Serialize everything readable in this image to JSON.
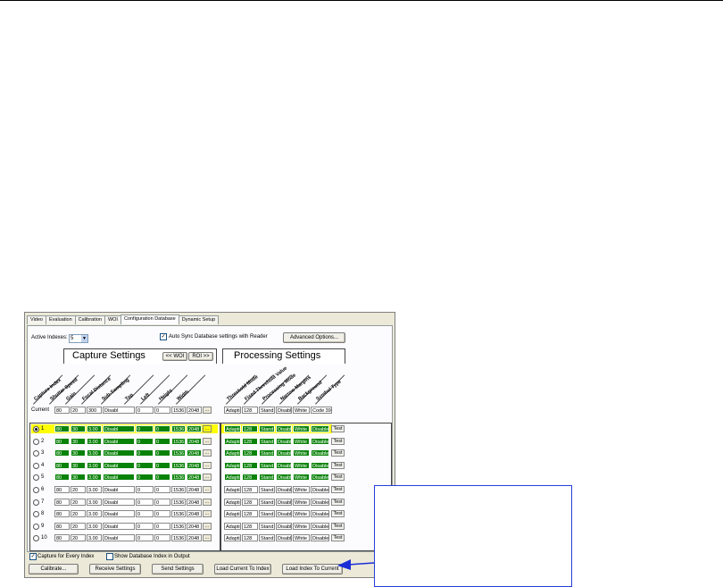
{
  "tabs": [
    {
      "label": "Video"
    },
    {
      "label": "Evaluation"
    },
    {
      "label": "Calibration"
    },
    {
      "label": "WOI"
    },
    {
      "label": "Configuration Database",
      "active": true
    },
    {
      "label": "Dynamic Setup"
    }
  ],
  "active_indexes": {
    "label": "Active Indexes:",
    "value": "5"
  },
  "auto_sync": {
    "label": "Auto Sync Database settings with Reader",
    "checked": true
  },
  "advanced_button": "Advanced Options...",
  "capture_title": "Capture Settings",
  "processing_title": "Processing Settings",
  "woi_button": "<< WOI",
  "roi_button": "ROI >>",
  "capture_columns": [
    "Capture Index",
    "Shutter Speed",
    "Gain",
    "Focal Distance",
    "Sub-Sampling",
    "Top",
    "Left",
    "Height",
    "Width"
  ],
  "processing_columns": [
    "Threshold Mode",
    "Fixed Threshold Value",
    "Processing Mode",
    "Narrow Margins",
    "Background",
    "Symbol Type"
  ],
  "current": {
    "label": "Current",
    "capture": [
      "80",
      "20",
      "300",
      "Disabl",
      "0",
      "0",
      "1536",
      "2048"
    ],
    "ellipsis": "...",
    "processing": [
      "Adapti",
      "128",
      "Stand",
      "Disabl",
      "White",
      "Code 39"
    ]
  },
  "rows": [
    {
      "index": "1",
      "selected": true,
      "active": true,
      "capture": [
        "80",
        "30",
        "3.00",
        "Disabl",
        "0",
        "0",
        "1536",
        "2048"
      ],
      "processing": [
        "Adapti",
        "128",
        "Stand",
        "Disabl",
        "White",
        "Disabled"
      ],
      "test": "Test"
    },
    {
      "index": "2",
      "active": true,
      "capture": [
        "80",
        "30",
        "3.00",
        "Disabl",
        "0",
        "0",
        "1536",
        "2048"
      ],
      "processing": [
        "Adapti",
        "128",
        "Stand",
        "Disabl",
        "White",
        "Disabled"
      ],
      "test": "Test"
    },
    {
      "index": "3",
      "active": true,
      "capture": [
        "80",
        "30",
        "3.00",
        "Disabl",
        "0",
        "0",
        "1536",
        "2048"
      ],
      "processing": [
        "Adapti",
        "128",
        "Stand",
        "Disabl",
        "White",
        "Disabled"
      ],
      "test": "Test"
    },
    {
      "index": "4",
      "active": true,
      "capture": [
        "80",
        "30",
        "3.00",
        "Disabl",
        "0",
        "0",
        "1536",
        "2048"
      ],
      "processing": [
        "Adapti",
        "128",
        "Stand",
        "Disabl",
        "White",
        "Disabled"
      ],
      "test": "Test"
    },
    {
      "index": "5",
      "active": true,
      "capture": [
        "80",
        "30",
        "3.00",
        "Disabl",
        "0",
        "0",
        "1536",
        "2048"
      ],
      "processing": [
        "Adapti",
        "128",
        "Stand",
        "Disabl",
        "White",
        "Disabled"
      ],
      "test": "Test"
    },
    {
      "index": "6",
      "active": false,
      "capture": [
        "80",
        "20",
        "3.00",
        "Disabl",
        "0",
        "0",
        "1536",
        "2048"
      ],
      "processing": [
        "Adapti",
        "128",
        "Stand",
        "Disabl",
        "White",
        "Disabled"
      ],
      "test": "Test"
    },
    {
      "index": "7",
      "active": false,
      "capture": [
        "80",
        "20",
        "3.00",
        "Disabl",
        "0",
        "0",
        "1536",
        "2048"
      ],
      "processing": [
        "Adapti",
        "128",
        "Stand",
        "Disabl",
        "White",
        "Disabled"
      ],
      "test": "Test"
    },
    {
      "index": "8",
      "active": false,
      "capture": [
        "80",
        "20",
        "3.00",
        "Disabl",
        "0",
        "0",
        "1536",
        "2048"
      ],
      "processing": [
        "Adapti",
        "128",
        "Stand",
        "Disabl",
        "White",
        "Disabled"
      ],
      "test": "Test"
    },
    {
      "index": "9",
      "active": false,
      "capture": [
        "80",
        "20",
        "3.00",
        "Disabl",
        "0",
        "0",
        "1536",
        "2048"
      ],
      "processing": [
        "Adapti",
        "128",
        "Stand",
        "Disabl",
        "White",
        "Disabled"
      ],
      "test": "Test"
    },
    {
      "index": "10",
      "active": false,
      "capture": [
        "80",
        "20",
        "3.00",
        "Disabl",
        "0",
        "0",
        "1536",
        "2048"
      ],
      "processing": [
        "Adapti",
        "128",
        "Stand",
        "Disabl",
        "White",
        "Disabled"
      ],
      "test": "Test"
    }
  ],
  "capture_every_index": {
    "label": "Capture for Every Index",
    "checked": true
  },
  "show_db_index": {
    "label": "Show Database Index in Output",
    "checked": false
  },
  "bottom_buttons": [
    "Calibrate...",
    "Receive Settings",
    "Send Settings",
    "Load Current To Index",
    "Load Index To Current"
  ],
  "colors": {
    "active_cell": "#098209",
    "selected_row": "#ffff00",
    "callout_border": "#2a3fd8",
    "arrow": "#1b2fd6"
  }
}
